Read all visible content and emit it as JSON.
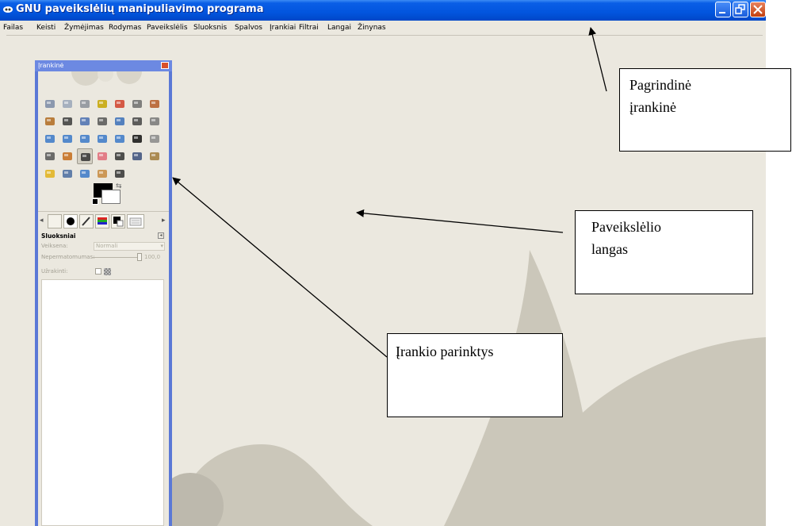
{
  "window": {
    "title": "GNU paveikslėlių manipuliavimo programa",
    "buttons": [
      "minimize",
      "restore",
      "close"
    ]
  },
  "menubar": {
    "items": [
      "Failas",
      "Keisti",
      "Žymėjimas",
      "Rodymas",
      "Paveikslėlis",
      "Sluoksnis",
      "Spalvos",
      "Įrankiai",
      "Filtrai",
      "Langai",
      "Žinynas"
    ]
  },
  "toolbox": {
    "title": "Įrankinė",
    "tools": [
      "rect-select-icon",
      "ellipse-select-icon",
      "lasso-icon",
      "fuzzy-select-icon",
      "color-select-icon",
      "scissors-icon",
      "foreground-select-icon",
      "paths-icon",
      "color-picker-icon",
      "zoom-icon",
      "measure-icon",
      "move-icon",
      "align-icon",
      "crop-icon",
      "rotate-icon",
      "scale-icon",
      "shear-icon",
      "perspective-icon",
      "flip-icon",
      "text-icon",
      "bucket-fill-icon",
      "blend-icon",
      "pencil-icon",
      "paintbrush-icon",
      "eraser-icon",
      "airbrush-icon",
      "ink-icon",
      "clone-icon",
      "heal-icon",
      "perspective-clone-icon",
      "blur-icon",
      "smudge-icon",
      "dodge-burn-icon"
    ],
    "active_tool": "paintbrush-icon",
    "fg_color": "#000000",
    "bg_color": "#ffffff"
  },
  "layers": {
    "title": "Sluoksniai",
    "mode_label": "Veiksena:",
    "mode_value": "Normali",
    "opacity_label": "Nepermatomumas:",
    "opacity_value": "100,0",
    "lock_label": "Užrakinti:"
  },
  "annotations": [
    {
      "line1": "Pagrindinė",
      "line2": "įrankinė"
    },
    {
      "line1": "Paveikslėlio",
      "line2": "langas"
    },
    {
      "line1": "Įrankio parinktys",
      "line2": ""
    }
  ],
  "colors": {
    "titlebar": "#0255de",
    "workspace": "#ebe8df",
    "decor": "#cbc7ba",
    "toolbox_frame": "#5a78d6"
  }
}
